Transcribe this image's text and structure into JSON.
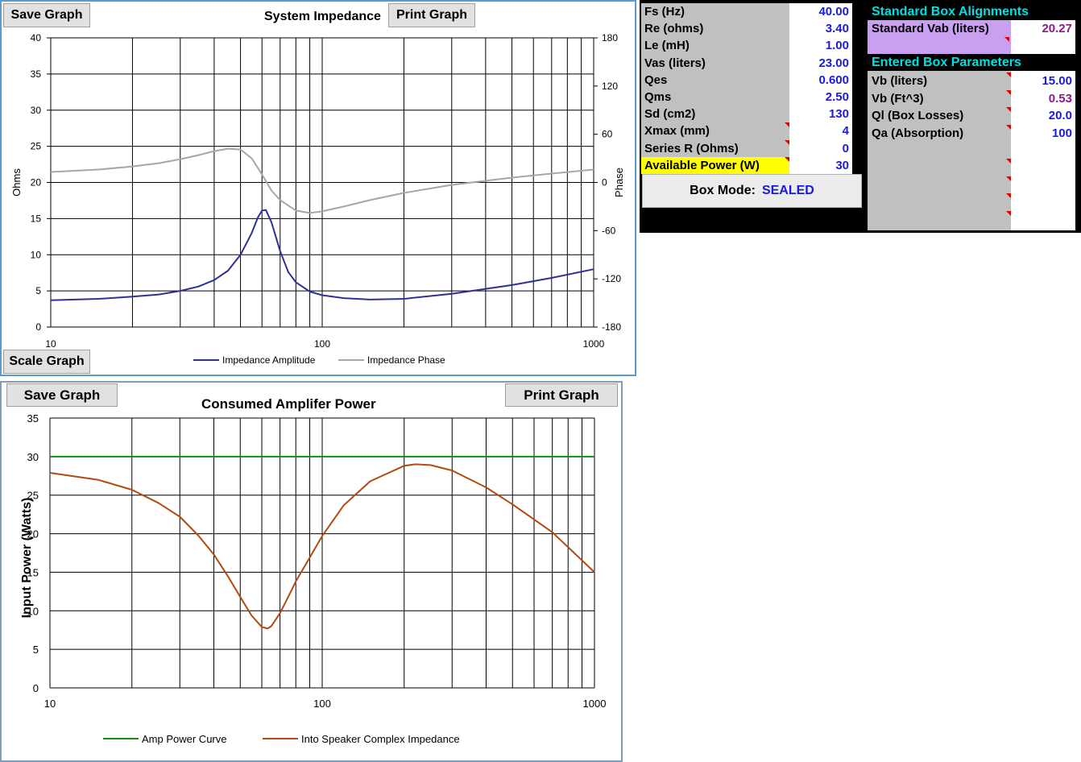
{
  "impedance_panel": {
    "save_label": "Save Graph",
    "print_label": "Print Graph",
    "scale_label": "Scale Graph",
    "title": "System Impedance",
    "y_left_label": "Ohms",
    "y_right_label": "Phase",
    "legend": [
      "Impedance Amplitude",
      "Impedance Phase"
    ],
    "colors": {
      "amplitude": "#2e3192",
      "phase": "#a6a6a6"
    }
  },
  "power_panel": {
    "save_label": "Save Graph",
    "print_label": "Print Graph",
    "title": "Consumed Amplifer Power",
    "y_label": "Input Power (Watts)",
    "legend": [
      "Amp Power Curve",
      "Into Speaker Complex Impedance"
    ],
    "colors": {
      "amp": "#168c16",
      "speaker": "#b04a10"
    }
  },
  "chart_data": [
    {
      "type": "line",
      "title": "System Impedance",
      "xscale": "log",
      "xlim": [
        10,
        1000
      ],
      "x_ticks": [
        "10",
        "100",
        "1000"
      ],
      "ylabel": "Ohms",
      "ylim": [
        0,
        40
      ],
      "y_ticks": [
        "0",
        "5",
        "10",
        "15",
        "20",
        "25",
        "30",
        "35",
        "40"
      ],
      "y2label": "Phase",
      "y2lim": [
        -180,
        180
      ],
      "y2_ticks": [
        "-180",
        "-120",
        "-60",
        "0",
        "60",
        "120",
        "180"
      ],
      "grid": true,
      "legend": "bottom",
      "series": [
        {
          "name": "Impedance Amplitude",
          "axis": "left",
          "x": [
            10,
            15,
            20,
            25,
            30,
            35,
            40,
            45,
            50,
            55,
            58,
            60,
            62,
            65,
            70,
            75,
            80,
            90,
            100,
            120,
            150,
            200,
            300,
            500,
            700,
            1000
          ],
          "y": [
            3.7,
            3.9,
            4.2,
            4.5,
            5.0,
            5.6,
            6.5,
            7.8,
            10.0,
            13.0,
            15.2,
            16.1,
            16.2,
            14.5,
            10.5,
            7.6,
            6.2,
            4.9,
            4.4,
            4.0,
            3.8,
            3.9,
            4.6,
            5.8,
            6.8,
            8.0
          ]
        },
        {
          "name": "Impedance Phase",
          "axis": "right",
          "x": [
            10,
            15,
            20,
            25,
            30,
            35,
            40,
            45,
            50,
            55,
            60,
            65,
            70,
            80,
            90,
            100,
            120,
            150,
            200,
            300,
            500,
            700,
            1000
          ],
          "y": [
            13,
            16,
            20,
            24,
            29,
            34,
            39,
            42,
            41,
            30,
            10,
            -10,
            -22,
            -35,
            -38,
            -36,
            -30,
            -22,
            -13,
            -3,
            6,
            11,
            16
          ]
        }
      ]
    },
    {
      "type": "line",
      "title": "Consumed Amplifer Power",
      "xscale": "log",
      "xlim": [
        10,
        1000
      ],
      "x_ticks": [
        "10",
        "100",
        "1000"
      ],
      "ylabel": "Input Power (Watts)",
      "ylim": [
        0,
        35
      ],
      "y_ticks": [
        "0",
        "5",
        "10",
        "15",
        "20",
        "25",
        "30",
        "35"
      ],
      "grid": true,
      "legend": "bottom",
      "series": [
        {
          "name": "Amp Power Curve",
          "x": [
            10,
            1000
          ],
          "y": [
            30,
            30
          ]
        },
        {
          "name": "Into Speaker Complex Impedance",
          "x": [
            10,
            15,
            20,
            25,
            30,
            35,
            40,
            45,
            50,
            55,
            60,
            63,
            65,
            70,
            75,
            80,
            90,
            100,
            120,
            150,
            200,
            220,
            250,
            300,
            400,
            500,
            700,
            1000
          ],
          "y": [
            27.9,
            27.0,
            25.7,
            24.0,
            22.2,
            19.8,
            17.3,
            14.5,
            11.8,
            9.4,
            7.9,
            7.7,
            8.0,
            9.7,
            11.8,
            13.8,
            16.9,
            19.7,
            23.7,
            26.8,
            28.8,
            29.0,
            28.9,
            28.2,
            26.0,
            23.8,
            20.2,
            15.0
          ]
        }
      ]
    }
  ],
  "parameters": {
    "rows": [
      {
        "label": "Fs (Hz)",
        "value": "40.00",
        "tick": false,
        "highlight": false
      },
      {
        "label": "Re (ohms)",
        "value": "3.40",
        "tick": false,
        "highlight": false
      },
      {
        "label": "Le (mH)",
        "value": "1.00",
        "tick": false,
        "highlight": false
      },
      {
        "label": "Vas (liters)",
        "value": "23.00",
        "tick": false,
        "highlight": false
      },
      {
        "label": "Qes",
        "value": "0.600",
        "tick": false,
        "highlight": false
      },
      {
        "label": "Qms",
        "value": "2.50",
        "tick": false,
        "highlight": false
      },
      {
        "label": "Sd (cm2)",
        "value": "130",
        "tick": false,
        "highlight": false
      },
      {
        "label": "Xmax (mm)",
        "value": "4",
        "tick": true,
        "highlight": false
      },
      {
        "label": "Series R (Ohms)",
        "value": "0",
        "tick": true,
        "highlight": false
      },
      {
        "label": "Available Power (W)",
        "value": "30",
        "tick": true,
        "highlight": true
      }
    ],
    "box_mode_label": "Box Mode:",
    "box_mode_value": "SEALED",
    "colors": {
      "value": "#1a1adc",
      "highlight": "#ffff00",
      "tick": "#e00000"
    }
  },
  "alignments": {
    "heading": "Standard Box Alignments",
    "std_label": "Standard Vab (liters)",
    "std_value": "20.27",
    "entered_heading": "Entered Box Parameters",
    "rows": [
      {
        "label": "Vb (liters)",
        "value": "15.00",
        "color": "#1a1adc"
      },
      {
        "label": "Vb (Ft^3)",
        "value": "0.53",
        "color": "#8b1a8b"
      },
      {
        "label": "Ql (Box Losses)",
        "value": "20.0",
        "color": "#1a1adc"
      },
      {
        "label": "Qa (Absorption)",
        "value": "100",
        "color": "#1a1adc"
      }
    ],
    "colors": {
      "heading": "#00e0e0",
      "std_bg": "#c9a0f0",
      "std_value": "#8b1a8b"
    }
  }
}
